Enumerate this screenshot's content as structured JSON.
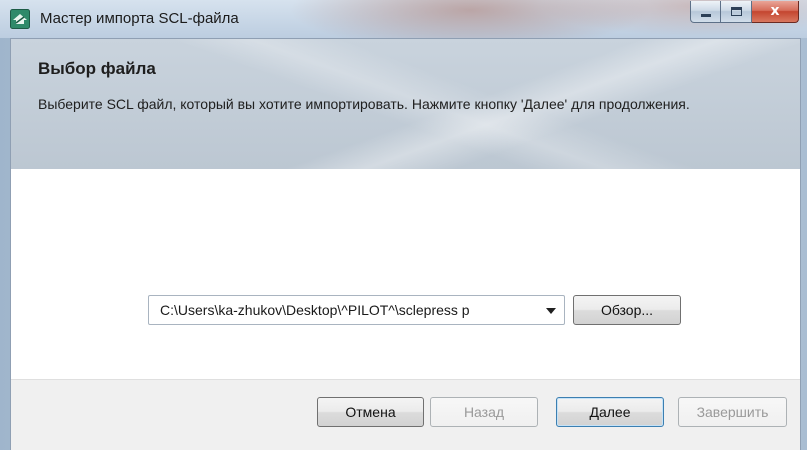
{
  "window": {
    "title": "Мастер импорта SCL-файла",
    "icon": "wizard-app-icon",
    "controls": {
      "minimize": "minimize-icon",
      "maximize": "maximize-icon",
      "close_glyph": "x"
    }
  },
  "header": {
    "title": "Выбор файла",
    "description": "Выберите SCL файл, который вы хотите импортировать. Нажмите кнопку 'Далее' для продолжения."
  },
  "file_picker": {
    "path_value": "C:\\Users\\ka-zhukov\\Desktop\\^PILOT^\\sclepress p",
    "browse_label": "Обзор..."
  },
  "footer": {
    "cancel_label": "Отмена",
    "back_label": "Назад",
    "back_enabled": false,
    "next_label": "Далее",
    "finish_label": "Завершить",
    "finish_enabled": false
  },
  "colors": {
    "close_button": "#c4452f",
    "default_button_border": "#3c7fb1",
    "header_bg": "#c9d3dd"
  }
}
